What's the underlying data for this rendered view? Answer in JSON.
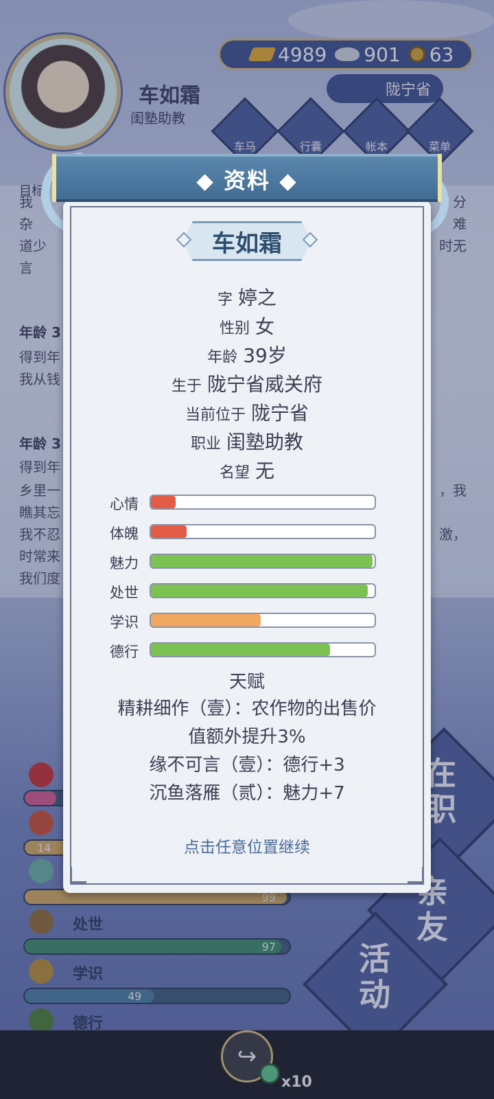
{
  "player": {
    "name": "车如霜",
    "occupation": "闺塾助教"
  },
  "currency": {
    "gold": "4989",
    "silver": "901",
    "coins": "63"
  },
  "region": "陇宁省",
  "menu": [
    "车马",
    "行囊",
    "帐本",
    "菜单"
  ],
  "side_tab": "目标",
  "background_text": {
    "line1": "我",
    "line1_right": "分",
    "line2": "杂",
    "line2_right": "难",
    "line3": "道少",
    "line3_right": "时无",
    "line4": "言",
    "age_heading_1": "年龄 3",
    "p1_a": "得到年",
    "p1_b": "我从钱",
    "age_heading_2": "年龄 3",
    "p2_a": "得到年",
    "p2_b": "乡里一",
    "p2_b_right": "，我",
    "p2_c": "瞧其忘",
    "p2_d": "我不忍",
    "p2_d_right": "激，",
    "p2_e": "时常来",
    "p2_f": "我们度"
  },
  "background_stats": [
    {
      "name": "",
      "value": "14"
    },
    {
      "name": "",
      "value": "99"
    },
    {
      "name": "处世",
      "value": "97"
    },
    {
      "name": "学识",
      "value": "49"
    },
    {
      "name": "德行",
      "value": ""
    }
  ],
  "background_buttons": {
    "b1_a": "在",
    "b1_b": "职",
    "b2_a": "亲",
    "b2_b": "友",
    "b3_a": "活",
    "b3_b": "动"
  },
  "bottom": {
    "multiplier": "x10"
  },
  "dialog": {
    "title": "资料",
    "name": "车如霜",
    "fields": [
      {
        "label": "字",
        "value": "婷之"
      },
      {
        "label": "性别",
        "value": "女"
      },
      {
        "label": "年龄",
        "value": "39岁"
      },
      {
        "label": "生于",
        "value": "陇宁省威关府"
      },
      {
        "label": "当前位于",
        "value": "陇宁省"
      },
      {
        "label": "职业",
        "value": "闺塾助教"
      },
      {
        "label": "名望",
        "value": "无"
      }
    ],
    "attributes": [
      {
        "label": "心情",
        "level": 0.11,
        "color": "#e35a45"
      },
      {
        "label": "体魄",
        "level": 0.16,
        "color": "#e35a45"
      },
      {
        "label": "魅力",
        "level": 0.99,
        "color": "#7bc252"
      },
      {
        "label": "处世",
        "level": 0.97,
        "color": "#7bc252"
      },
      {
        "label": "学识",
        "level": 0.49,
        "color": "#f0a860"
      },
      {
        "label": "德行",
        "level": 0.8,
        "color": "#7bc252"
      }
    ],
    "talent_title": "天赋",
    "talent_1a": "精耕细作（壹）：农作物的出售价",
    "talent_1b": "值额外提升3%",
    "talent_2": "缘不可言（壹）：德行+3",
    "talent_3": "沉鱼落雁（贰）：魅力+7",
    "continue_hint": "点击任意位置继续"
  }
}
